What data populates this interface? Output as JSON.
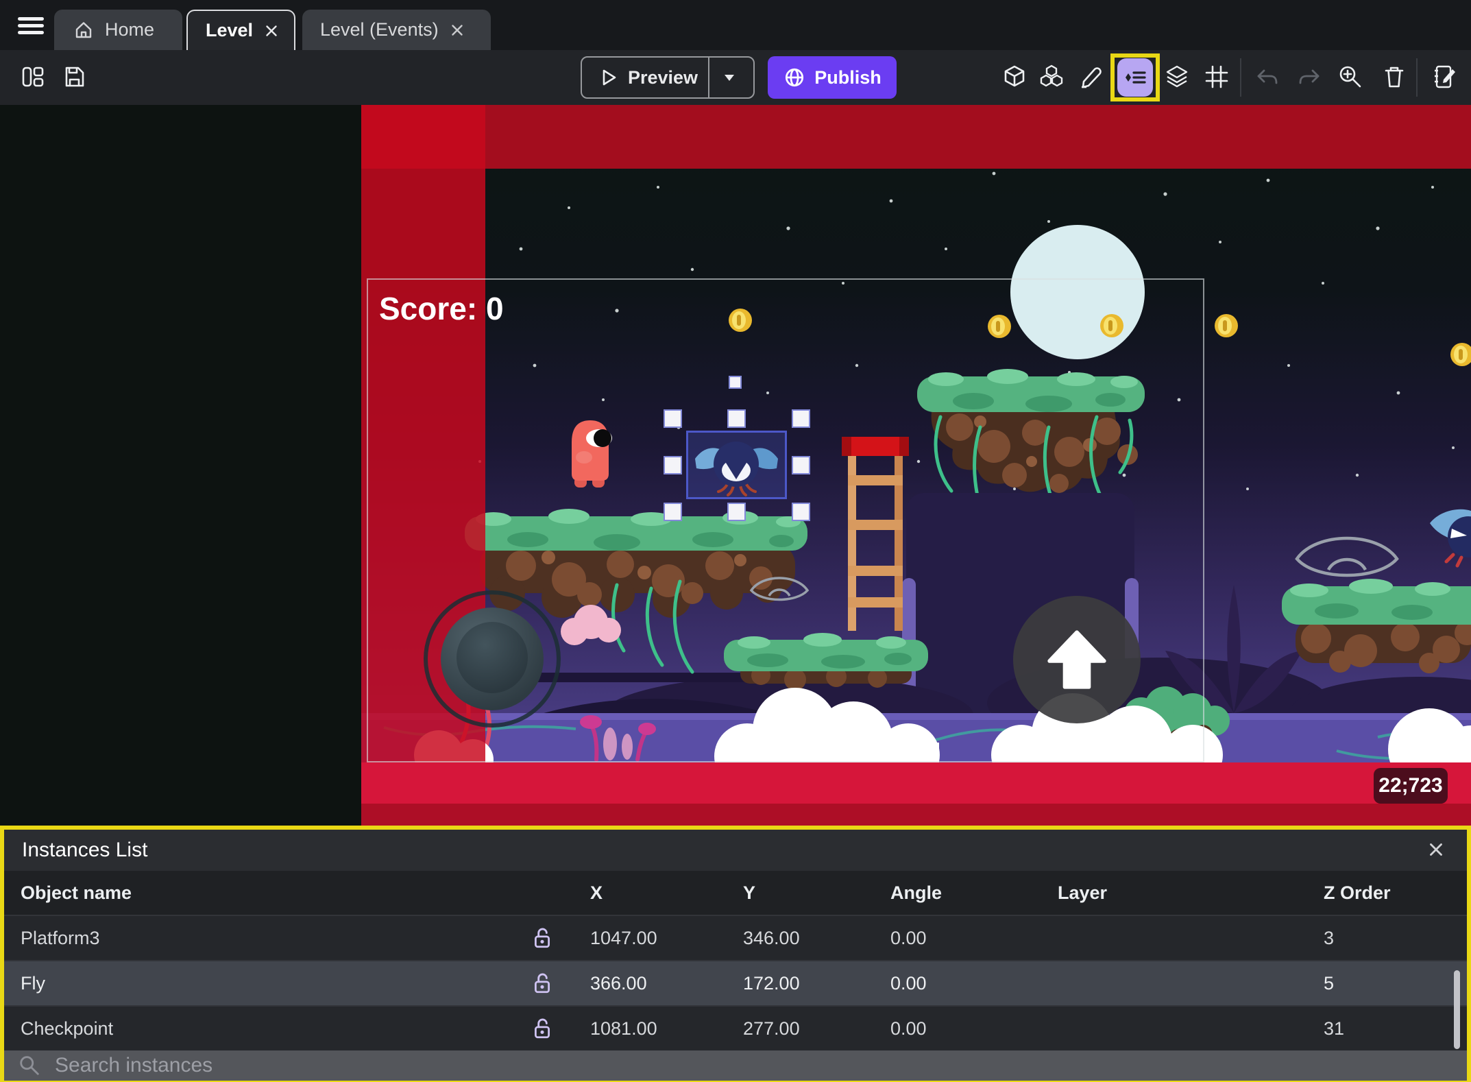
{
  "tab_bar": {
    "tabs": [
      {
        "label": "Home",
        "icon": "home-icon",
        "active": false
      },
      {
        "label": "Level",
        "active": true,
        "closable": true
      },
      {
        "label": "Level (Events)",
        "active": false,
        "closable": true
      }
    ]
  },
  "toolbar": {
    "preview_label": "Preview",
    "publish_label": "Publish",
    "icons": [
      "project-manager",
      "save",
      "play",
      "preview-options-caret",
      "globe",
      "objects-cube",
      "object-groups",
      "edit-pencil",
      "instances-list",
      "layers",
      "grid",
      "undo",
      "redo",
      "zoom-in",
      "trash",
      "scene-properties"
    ],
    "highlighted_icon": "instances-list"
  },
  "scene": {
    "score_text": "Score: 0",
    "coordinates_badge": "22;723",
    "selected_object": "Fly"
  },
  "instances_panel": {
    "title": "Instances List",
    "close_icon": "close-x",
    "columns": [
      "Object name",
      "X",
      "Y",
      "Angle",
      "Layer",
      "Z Order"
    ],
    "rows": [
      {
        "name": "Platform3",
        "locked": false,
        "x": "1047.00",
        "y": "346.00",
        "angle": "0.00",
        "layer": "",
        "z_order": "3",
        "selected": false
      },
      {
        "name": "Fly",
        "locked": false,
        "x": "366.00",
        "y": "172.00",
        "angle": "0.00",
        "layer": "",
        "z_order": "5",
        "selected": true
      },
      {
        "name": "Checkpoint",
        "locked": false,
        "x": "1081.00",
        "y": "277.00",
        "angle": "0.00",
        "layer": "",
        "z_order": "31",
        "selected": false
      }
    ],
    "search_placeholder": "Search instances"
  },
  "colors": {
    "accent_purple": "#6b3df2",
    "highlight_yellow": "#e9d815",
    "selection_blue": "#4c58c8",
    "red_overlay": "#c00d20",
    "panel_bg": "#25272b",
    "lock_icon": "#cfc3f2"
  }
}
